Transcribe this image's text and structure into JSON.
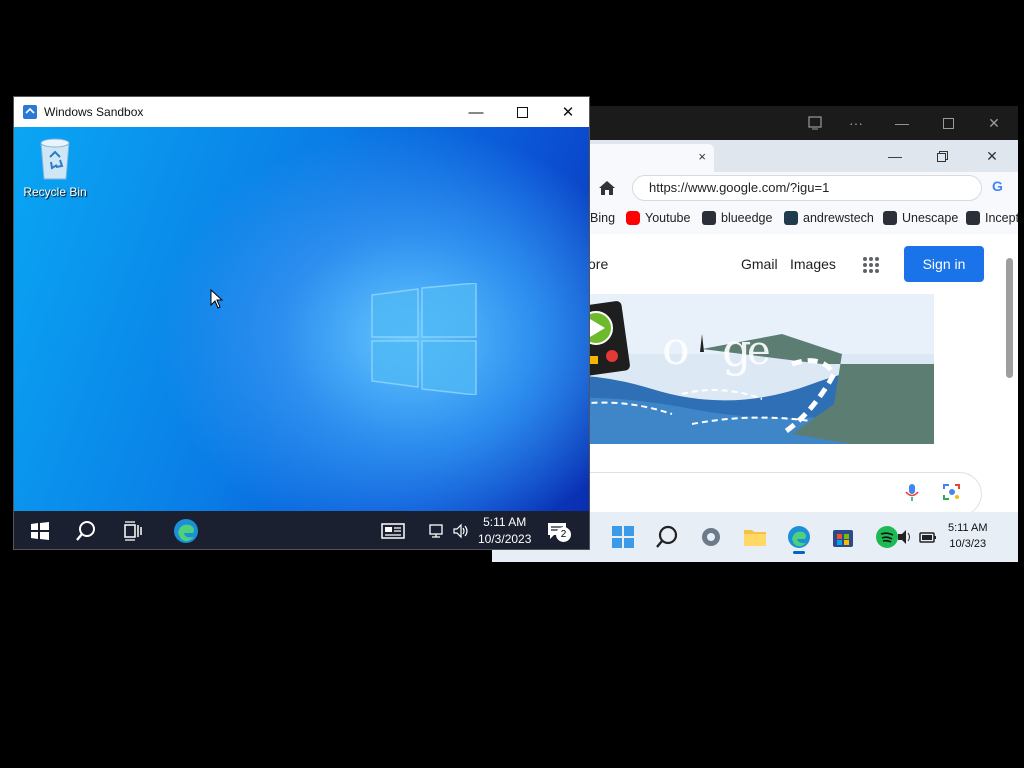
{
  "remote_window": {
    "icons": [
      "cast-icon",
      "more-icon",
      "minimize-icon",
      "maximize-icon",
      "close-icon"
    ],
    "browser": {
      "tab_close": "×",
      "address": "https://www.google.com/?igu=1",
      "bookmarks": [
        {
          "label": "Bing",
          "icon": "bing-icon"
        },
        {
          "label": "Youtube",
          "icon": "youtube-icon",
          "color": "#ff0000"
        },
        {
          "label": "blueedge",
          "icon": "react-icon",
          "color": "#2a2f38"
        },
        {
          "label": "andrewstech",
          "icon": "site-icon",
          "color": "#1f3b4d"
        },
        {
          "label": "Unescape",
          "icon": "react-icon",
          "color": "#2a2f38"
        },
        {
          "label": "Incept",
          "icon": "react-icon",
          "color": "#2a2f38"
        }
      ],
      "page": {
        "more_link": "ore",
        "gmail": "Gmail",
        "images": "Images",
        "signin": "Sign in"
      }
    },
    "taskbar": {
      "icons": [
        "start-icon",
        "search-icon",
        "settings-icon",
        "folder-icon",
        "edge-icon",
        "store-icon",
        "spotify-icon",
        "volume-icon",
        "battery-icon"
      ],
      "time": "5:11 AM",
      "date": "10/3/23"
    }
  },
  "sandbox_window": {
    "title": "Windows Sandbox",
    "desktop": {
      "recycle_bin_label": "Recycle Bin"
    },
    "taskbar": {
      "time": "5:11 AM",
      "date": "10/3/2023",
      "notification_count": "2"
    }
  },
  "colors": {
    "signin_blue": "#1a73e8",
    "taskbar_dark": "#1a2030"
  }
}
